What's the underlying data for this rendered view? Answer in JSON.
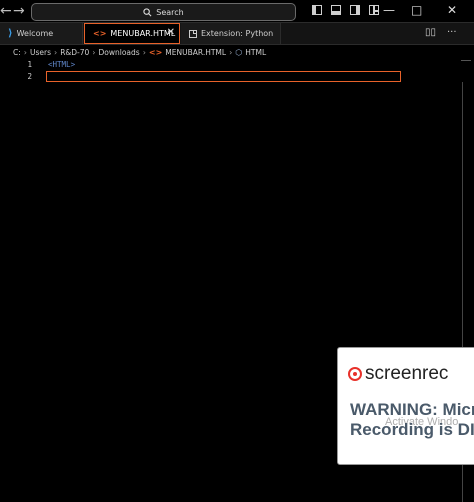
{
  "titlebar": {
    "back_arrow": "←",
    "forward_arrow": "→",
    "search_label": "Search",
    "window_controls": [
      "—",
      "□",
      "✕"
    ]
  },
  "tabs": [
    {
      "label": "Welcome",
      "icon": "vscode-logo-icon"
    },
    {
      "label": "MENUBAR.HTML",
      "icon": "html-brackets-icon",
      "active": true
    },
    {
      "label": "Extension: Python",
      "icon": "extension-icon"
    }
  ],
  "breadcrumb": [
    "C:",
    "Users",
    "R&D-70",
    "Downloads",
    "MENUBAR.HTML",
    "HTML"
  ],
  "editor": {
    "lines": [
      {
        "number": "1",
        "text": "<HTML>"
      },
      {
        "number": "2",
        "text": ""
      }
    ]
  },
  "popup": {
    "brand": "screenrec",
    "warning_line1": "WARNING: Micr",
    "warning_line2": "Recording is DIS",
    "activate_watermark": "Activate Windo"
  },
  "colors": {
    "accent": "#e8622a",
    "tag_blue": "#5f86c9",
    "background": "#000000"
  }
}
